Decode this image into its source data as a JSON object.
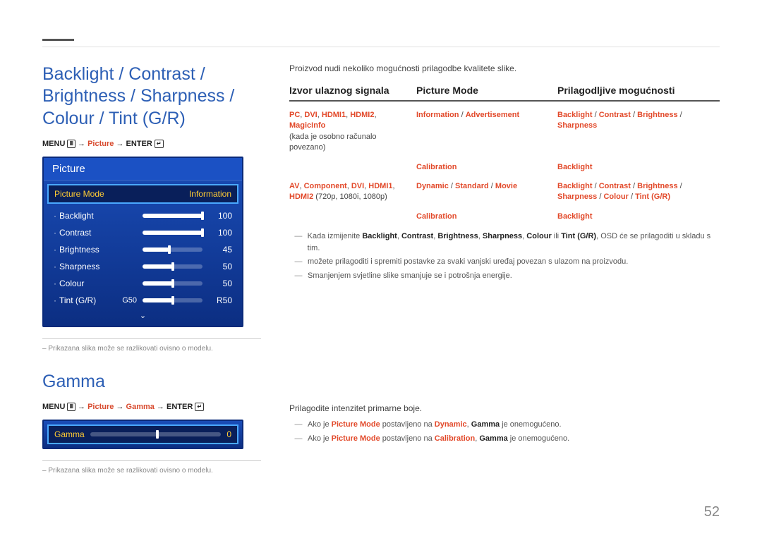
{
  "page_number": "52",
  "section1": {
    "title": "Backlight / Contrast / Brightness / Sharpness / Colour / Tint (G/R)",
    "menu_path_prefix": "MENU",
    "menu_path_middle": "Picture",
    "menu_path_suffix": "ENTER",
    "osd": {
      "header": "Picture",
      "selected_label": "Picture Mode",
      "selected_value": "Information",
      "items": [
        {
          "label": "Backlight",
          "value": "100",
          "fill": 100
        },
        {
          "label": "Contrast",
          "value": "100",
          "fill": 100
        },
        {
          "label": "Brightness",
          "value": "45",
          "fill": 45
        },
        {
          "label": "Sharpness",
          "value": "50",
          "fill": 50
        },
        {
          "label": "Colour",
          "value": "50",
          "fill": 50
        },
        {
          "label": "Tint (G/R)",
          "pre": "G50",
          "value": "R50",
          "fill": 50
        }
      ]
    },
    "footnote": "Prikazana slika može se razlikovati ovisno o modelu."
  },
  "section2": {
    "title": "Gamma",
    "menu_path_prefix": "MENU",
    "menu_path_m1": "Picture",
    "menu_path_m2": "Gamma",
    "menu_path_suffix": "ENTER",
    "osd": {
      "label": "Gamma",
      "value": "0",
      "fill": 50
    },
    "footnote": "Prikazana slika može se razlikovati ovisno o modelu."
  },
  "right": {
    "intro": "Proizvod nudi nekoliko mogućnosti prilagodbe kvalitete slike.",
    "headers": {
      "c1": "Izvor ulaznog signala",
      "c2": "Picture Mode",
      "c3": "Prilagodljive mogućnosti"
    },
    "row1": {
      "c1_html": "<span class='red'>PC</span><span class='slash'>, </span><span class='red'>DVI</span><span class='slash'>, </span><span class='red'>HDMI1</span><span class='slash'>, </span><span class='red'>HDMI2</span><span class='slash'>, </span><span class='red'>MagicInfo</span><br><span class='muted'>(kada je osobno računalo povezano)</span>",
      "c2a_html": "<span class='red'>Information</span> <span class='slash'>/</span> <span class='red'>Advertisement</span>",
      "c3a_html": "<span class='red'>Backlight</span> <span class='slash'>/</span> <span class='red'>Contrast</span> <span class='slash'>/</span> <span class='red'>Brightness</span> <span class='slash'>/</span> <span class='red'>Sharpness</span>",
      "c2b_html": "<span class='red'>Calibration</span>",
      "c3b_html": "<span class='red'>Backlight</span>"
    },
    "row2": {
      "c1_html": "<span class='red'>AV</span><span class='slash'>, </span><span class='red'>Component</span><span class='slash'>, </span><span class='red'>DVI</span><span class='slash'>, </span><span class='red'>HDMI1</span><span class='slash'>, </span><span class='red'>HDMI2</span> <span class='muted'>(720p, 1080i, 1080p)</span>",
      "c2a_html": "<span class='red'>Dynamic</span> <span class='slash'>/</span> <span class='red'>Standard</span> <span class='slash'>/</span> <span class='red'>Movie</span>",
      "c3a_html": "<span class='red'>Backlight</span> <span class='slash'>/</span> <span class='red'>Contrast</span> <span class='slash'>/</span> <span class='red'>Brightness</span> <span class='slash'>/</span> <span class='red'>Sharpness</span> <span class='slash'>/</span> <span class='red'>Colour</span> <span class='slash'>/</span> <span class='red'>Tint (G/R)</span>",
      "c2b_html": "<span class='red'>Calibration</span>",
      "c3b_html": "<span class='red'>Backlight</span>"
    },
    "notes": [
      "Kada izmijenite <span class='bld'>Backlight</span>, <span class='bld'>Contrast</span>, <span class='bld'>Brightness</span>, <span class='bld'>Sharpness</span>, <span class='bld'>Colour</span> ili <span class='bld'>Tint (G/R)</span>, OSD će se prilagoditi u skladu s tim.",
      "možete prilagoditi i spremiti postavke za svaki vanjski uređaj povezan s ulazom na proizvodu.",
      "Smanjenjem svjetline slike smanjuje se i potrošnja energije."
    ],
    "gamma_desc": "Prilagodite intenzitet primarne boje.",
    "gamma_notes": [
      "Ako je <span class='red'>Picture Mode</span> postavljeno na <span class='red'>Dynamic</span>, <span class='bld'>Gamma</span> je onemogućeno.",
      "Ako je <span class='red'>Picture Mode</span> postavljeno na <span class='red'>Calibration</span>, <span class='bld'>Gamma</span> je onemogućeno."
    ]
  }
}
